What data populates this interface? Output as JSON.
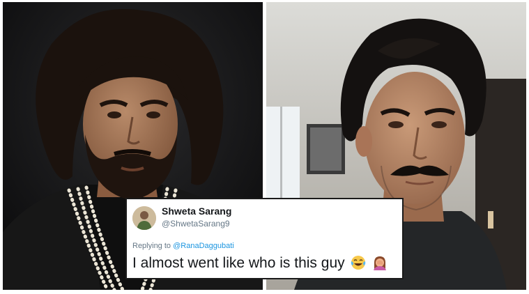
{
  "tweet": {
    "display_name": "Shweta Sarang",
    "handle": "@ShwetaSarang9",
    "replying_to_label": "Replying to",
    "replying_to_handle": "@RanaDaggubati",
    "text": "I almost went like who is this guy",
    "emojis": [
      "face-with-tears-of-joy-emoji",
      "woman-facepalming-emoji"
    ]
  },
  "colors": {
    "link": "#1b95e0",
    "secondary_text": "#657786",
    "primary_text": "#14171a",
    "card_border": "#1a1a1a"
  }
}
